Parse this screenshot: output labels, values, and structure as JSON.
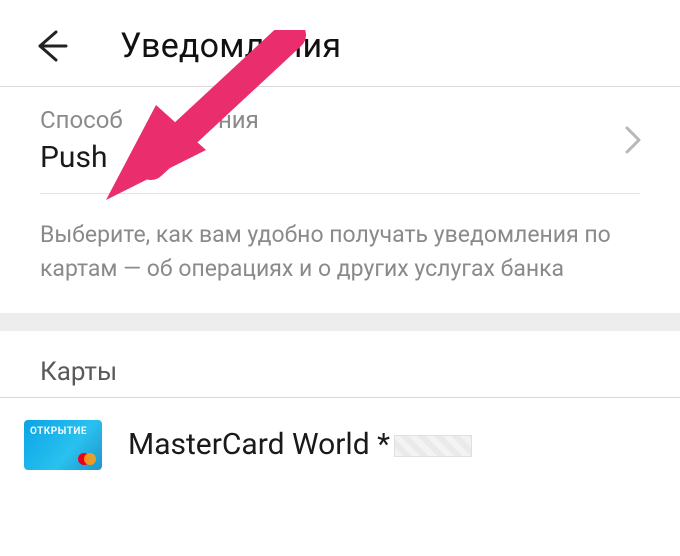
{
  "header": {
    "title": "Уведомления"
  },
  "method": {
    "label_visible": "Способ",
    "label_suffix_visible": "ния",
    "value": "Push"
  },
  "help_text": "Выберите, как вам удобно получать уведомления по картам — об операциях и о других услугах банка",
  "cards_section": {
    "title": "Карты",
    "items": [
      {
        "name": "MasterCard World",
        "mask_prefix": "*",
        "card_bank_text": "ОТКРЫТИЕ"
      }
    ]
  },
  "annotation": {
    "type": "arrow",
    "color": "#ea2e6d"
  }
}
